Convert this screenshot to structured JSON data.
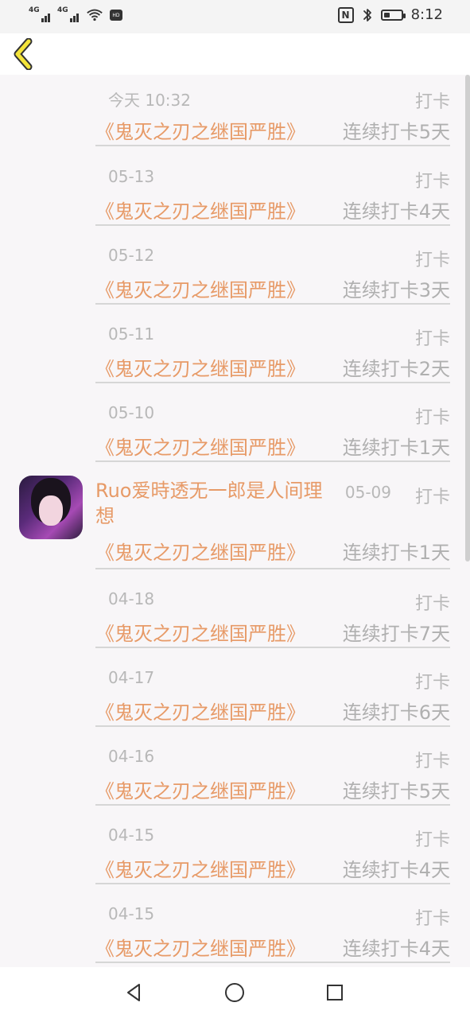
{
  "status_bar": {
    "network_1": "4G",
    "network_2": "4G",
    "hd_badge": "HD",
    "nfc_icon_label": "N",
    "time": "8:12"
  },
  "items": [
    {
      "date": "今天 10:32",
      "tag": "打卡",
      "book": "《鬼灭之刃之继国严胜》",
      "streak": "连续打卡5天"
    },
    {
      "date": "05-13",
      "tag": "打卡",
      "book": "《鬼灭之刃之继国严胜》",
      "streak": "连续打卡4天"
    },
    {
      "date": "05-12",
      "tag": "打卡",
      "book": "《鬼灭之刃之继国严胜》",
      "streak": "连续打卡3天"
    },
    {
      "date": "05-11",
      "tag": "打卡",
      "book": "《鬼灭之刃之继国严胜》",
      "streak": "连续打卡2天"
    },
    {
      "date": "05-10",
      "tag": "打卡",
      "book": "《鬼灭之刃之继国严胜》",
      "streak": "连续打卡1天"
    },
    {
      "date": "04-18",
      "tag": "打卡",
      "book": "《鬼灭之刃之继国严胜》",
      "streak": "连续打卡7天"
    },
    {
      "date": "04-17",
      "tag": "打卡",
      "book": "《鬼灭之刃之继国严胜》",
      "streak": "连续打卡6天"
    },
    {
      "date": "04-16",
      "tag": "打卡",
      "book": "《鬼灭之刃之继国严胜》",
      "streak": "连续打卡5天"
    },
    {
      "date": "04-15",
      "tag": "打卡",
      "book": "《鬼灭之刃之继国严胜》",
      "streak": "连续打卡4天"
    },
    {
      "date": "04-15",
      "tag": "打卡",
      "book": "《鬼灭之刃之继国严胜》",
      "streak": "连续打卡4天"
    }
  ],
  "user_item": {
    "username": "Ruo爱時透无一郎是人间理想",
    "date": "05-09",
    "tag": "打卡",
    "book": "《鬼灭之刃之继国严胜》",
    "streak": "连续打卡1天"
  },
  "icons": {
    "back": "back-arrow-icon",
    "nav_back": "nav-back-icon",
    "nav_home": "nav-home-icon",
    "nav_recent": "nav-recent-icon"
  },
  "colors": {
    "accent": "#e79a67",
    "muted": "#b8b8b8",
    "back_icon": "#f4e43a"
  }
}
